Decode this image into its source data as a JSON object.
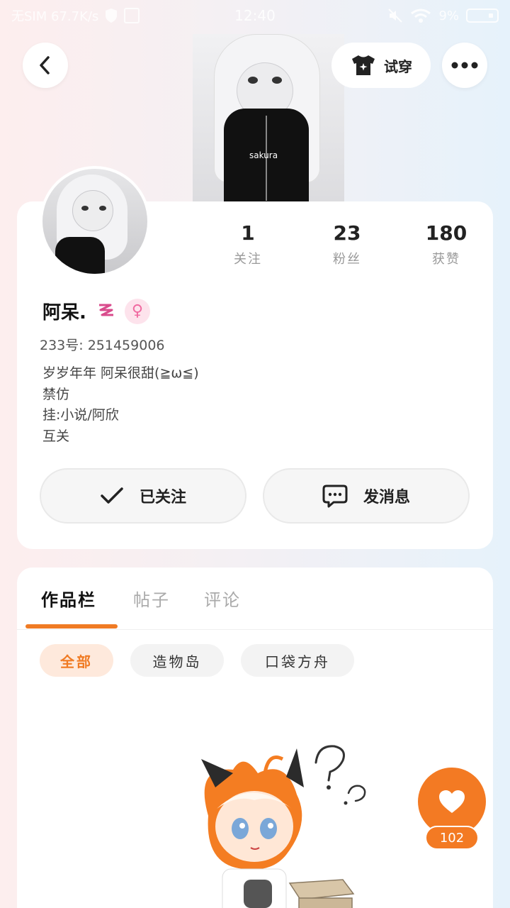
{
  "status_bar": {
    "carrier": "无SIM 67.7K/s",
    "time": "12:40",
    "battery": "9%"
  },
  "header": {
    "back_icon": "chevron-left-icon",
    "try_on_label": "试穿",
    "try_on_icon": "tshirt-sparkle-icon",
    "more_icon": "more-dots-icon",
    "hero_shirt_text": "sakura"
  },
  "profile": {
    "stats": [
      {
        "value": "1",
        "label": "关注"
      },
      {
        "value": "23",
        "label": "粉丝"
      },
      {
        "value": "180",
        "label": "获赞"
      }
    ],
    "name": "阿呆.",
    "name_suffix_icon": "sleep-z-icon",
    "gender_symbol": "♀",
    "uid": "233号: 251459006",
    "bio": [
      "岁岁年年  阿呆很甜(≧ω≦)",
      "禁仿",
      "挂:小说/阿欣",
      "互关"
    ],
    "follow_button": "已关注",
    "message_button": "发消息"
  },
  "works": {
    "tabs": [
      "作品栏",
      "帖子",
      "评论"
    ],
    "active_tab": "作品栏",
    "chips": [
      "全部",
      "造物岛",
      "口袋方舟"
    ],
    "active_chip": "全部"
  },
  "like": {
    "count": "102"
  },
  "colors": {
    "accent": "#f37a23",
    "chip_active_bg": "#fee9dc",
    "gender_pink": "#f06aa0"
  }
}
